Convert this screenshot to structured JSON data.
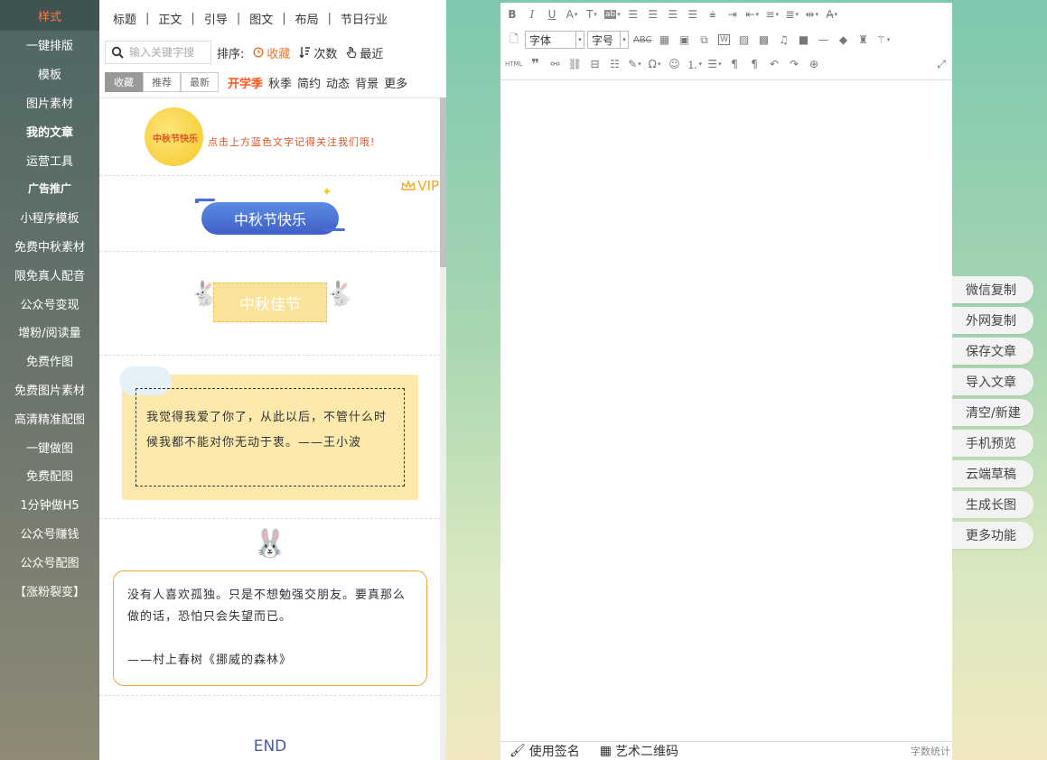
{
  "left_nav": [
    {
      "label": "样式"
    },
    {
      "label": "一键排版"
    },
    {
      "label": "模板"
    },
    {
      "label": "图片素材"
    },
    {
      "label": "我的文章"
    },
    {
      "label": "运营工具"
    },
    {
      "label": "广告推广"
    },
    {
      "label": "小程序模板"
    },
    {
      "label": "免费中秋素材"
    },
    {
      "label": "限免真人配音"
    },
    {
      "label": "公众号变现"
    },
    {
      "label": "增粉/阅读量"
    },
    {
      "label": "免费作图"
    },
    {
      "label": "免费图片素材"
    },
    {
      "label": "高清精准配图"
    },
    {
      "label": "一键做图"
    },
    {
      "label": "免费配图"
    },
    {
      "label": "1分钟做H5"
    },
    {
      "label": "公众号赚钱"
    },
    {
      "label": "公众号配图"
    },
    {
      "label": "【涨粉裂变】"
    }
  ],
  "panel": {
    "category_tabs": [
      "标题",
      "正文",
      "引导",
      "图文",
      "布局",
      "节日行业"
    ],
    "search_placeholder": "输入关键字搜",
    "sort_label": "排序:",
    "sort_options": [
      {
        "label": "收藏",
        "active": true
      },
      {
        "label": "次数"
      },
      {
        "label": "最近"
      }
    ],
    "filter_tabs": [
      {
        "label": "收藏",
        "active": true
      },
      {
        "label": "推荐"
      },
      {
        "label": "最新"
      }
    ],
    "tags": [
      {
        "label": "开学季",
        "hot": true
      },
      {
        "label": "秋季"
      },
      {
        "label": "简约"
      },
      {
        "label": "动态"
      },
      {
        "label": "背景"
      },
      {
        "label": "更多"
      }
    ],
    "cards": {
      "card1": {
        "badge": "中秋节快乐",
        "text": "点击上方蓝色文字记得关注我们哦!"
      },
      "card2": {
        "vip": "VIP",
        "title": "中秋节快乐"
      },
      "card3": {
        "title": "中秋佳节"
      },
      "card4": {
        "quote": "我觉得我爱了你了，从此以后，不管什么时候我都不能对你无动于衷。——王小波"
      },
      "card5": {
        "quote": "没有人喜欢孤独。只是不想勉强交朋友。要真那么做的话，恐怕只会失望而已。",
        "source": "——村上春树《挪威的森林》"
      },
      "end": "END"
    }
  },
  "editor": {
    "font_select": "字体",
    "size_select": "字号",
    "footer": {
      "signature": "使用签名",
      "qrcode": "艺术二维码",
      "word_count": "字数统计"
    }
  },
  "actions": [
    "微信复制",
    "外网复制",
    "保存文章",
    "导入文章",
    "清空/新建",
    "手机预览",
    "云端草稿",
    "生成长图",
    "更多功能"
  ],
  "colors": {
    "accent": "#ff7a45",
    "nav_active_bg": "#3f5452",
    "panel_blue": "#4a6fd6",
    "highlight_yellow": "#fbe29a"
  }
}
